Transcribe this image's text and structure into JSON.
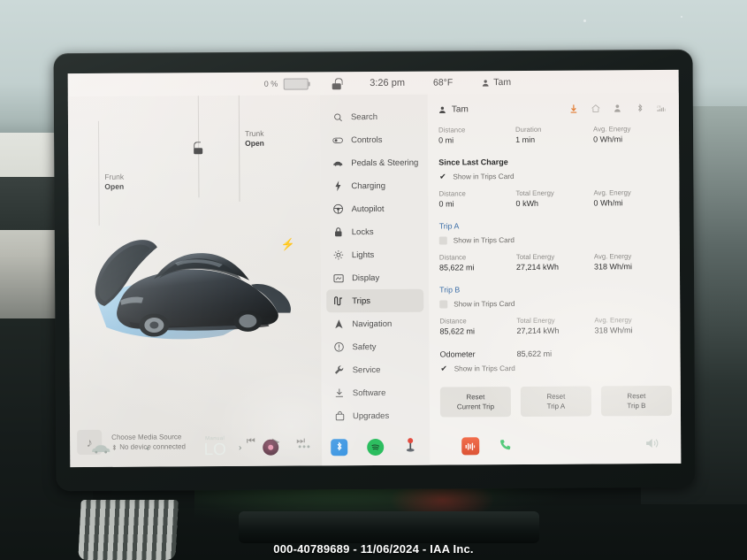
{
  "statusbar": {
    "battery_percent": "0 %",
    "time": "3:26 pm",
    "temperature": "68°F",
    "driver": "Tam"
  },
  "car_panel": {
    "frunk_label_top": "Frunk",
    "frunk_label_bottom": "Open",
    "trunk_label_top": "Trunk",
    "trunk_label_bottom": "Open"
  },
  "media": {
    "title": "Choose Media Source",
    "subtitle": "No device connected",
    "prev_icon": "skip-previous-icon",
    "play_icon": "play-icon",
    "next_icon": "skip-next-icon"
  },
  "sidebar": {
    "items": [
      {
        "label": "Search",
        "icon": "search-icon",
        "active": false
      },
      {
        "label": "Controls",
        "icon": "controls-icon",
        "active": false
      },
      {
        "label": "Pedals & Steering",
        "icon": "car-icon",
        "active": false
      },
      {
        "label": "Charging",
        "icon": "bolt-icon",
        "active": false
      },
      {
        "label": "Autopilot",
        "icon": "steering-wheel-icon",
        "active": false
      },
      {
        "label": "Locks",
        "icon": "lock-icon",
        "active": false
      },
      {
        "label": "Lights",
        "icon": "lights-icon",
        "active": false
      },
      {
        "label": "Display",
        "icon": "display-icon",
        "active": false
      },
      {
        "label": "Trips",
        "icon": "trips-icon",
        "active": true
      },
      {
        "label": "Navigation",
        "icon": "navigation-icon",
        "active": false
      },
      {
        "label": "Safety",
        "icon": "safety-icon",
        "active": false
      },
      {
        "label": "Service",
        "icon": "wrench-icon",
        "active": false
      },
      {
        "label": "Software",
        "icon": "download-icon",
        "active": false
      },
      {
        "label": "Upgrades",
        "icon": "bag-icon",
        "active": false
      }
    ]
  },
  "trips": {
    "driver": "Tam",
    "status_icons": [
      "charge-arrow-icon",
      "home-icon",
      "person-icon",
      "bluetooth-icon",
      "lte-signal-icon"
    ],
    "current": {
      "distance_label": "Distance",
      "distance_value": "0 mi",
      "duration_label": "Duration",
      "duration_value": "1 min",
      "avg_energy_label": "Avg. Energy",
      "avg_energy_value": "0 Wh/mi"
    },
    "since_last_charge": {
      "title": "Since Last Charge",
      "show_in_card_label": "Show in Trips Card",
      "show_in_card_checked": true,
      "distance_label": "Distance",
      "distance_value": "0 mi",
      "total_energy_label": "Total Energy",
      "total_energy_value": "0 kWh",
      "avg_energy_label": "Avg. Energy",
      "avg_energy_value": "0 Wh/mi"
    },
    "trip_a": {
      "title": "Trip A",
      "show_in_card_label": "Show in Trips Card",
      "show_in_card_checked": false,
      "distance_label": "Distance",
      "distance_value": "85,622 mi",
      "total_energy_label": "Total Energy",
      "total_energy_value": "27,214 kWh",
      "avg_energy_label": "Avg. Energy",
      "avg_energy_value": "318 Wh/mi"
    },
    "trip_b": {
      "title": "Trip B",
      "show_in_card_label": "Show in Trips Card",
      "show_in_card_checked": false,
      "distance_label": "Distance",
      "distance_value": "85,622 mi",
      "total_energy_label": "Total Energy",
      "total_energy_value": "27,214 kWh",
      "avg_energy_label": "Avg. Energy",
      "avg_energy_value": "318 Wh/mi"
    },
    "odometer": {
      "label": "Odometer",
      "value": "85,622 mi",
      "show_in_card_label": "Show in Trips Card",
      "show_in_card_checked": true
    },
    "buttons": [
      {
        "line1": "Reset",
        "line2": "Current Trip"
      },
      {
        "line1": "Reset",
        "line2": "Trip A"
      },
      {
        "line1": "Reset",
        "line2": "Trip B"
      }
    ]
  },
  "dock": {
    "car_icon": "car-icon",
    "climate_mode": "Manual",
    "climate_temp": "LO",
    "eq_icon": "media-equalizer-icon",
    "phone_icon": "phone-icon",
    "camera_icon": "camera-icon",
    "dots_icon": "more-apps-icon",
    "bluetooth_icon": "bluetooth-icon",
    "spotify_icon": "spotify-icon",
    "pin_icon": "joystick-icon",
    "volume_icon": "volume-icon"
  },
  "watermark": {
    "text": "000-40789689 - 11/06/2024 - IAA Inc."
  },
  "colors": {
    "accent_blue": "#3d6fa8",
    "charge_orange": "#e0701f",
    "spotify_green": "#1db954",
    "bluetooth_blue": "#2f8fe0"
  }
}
